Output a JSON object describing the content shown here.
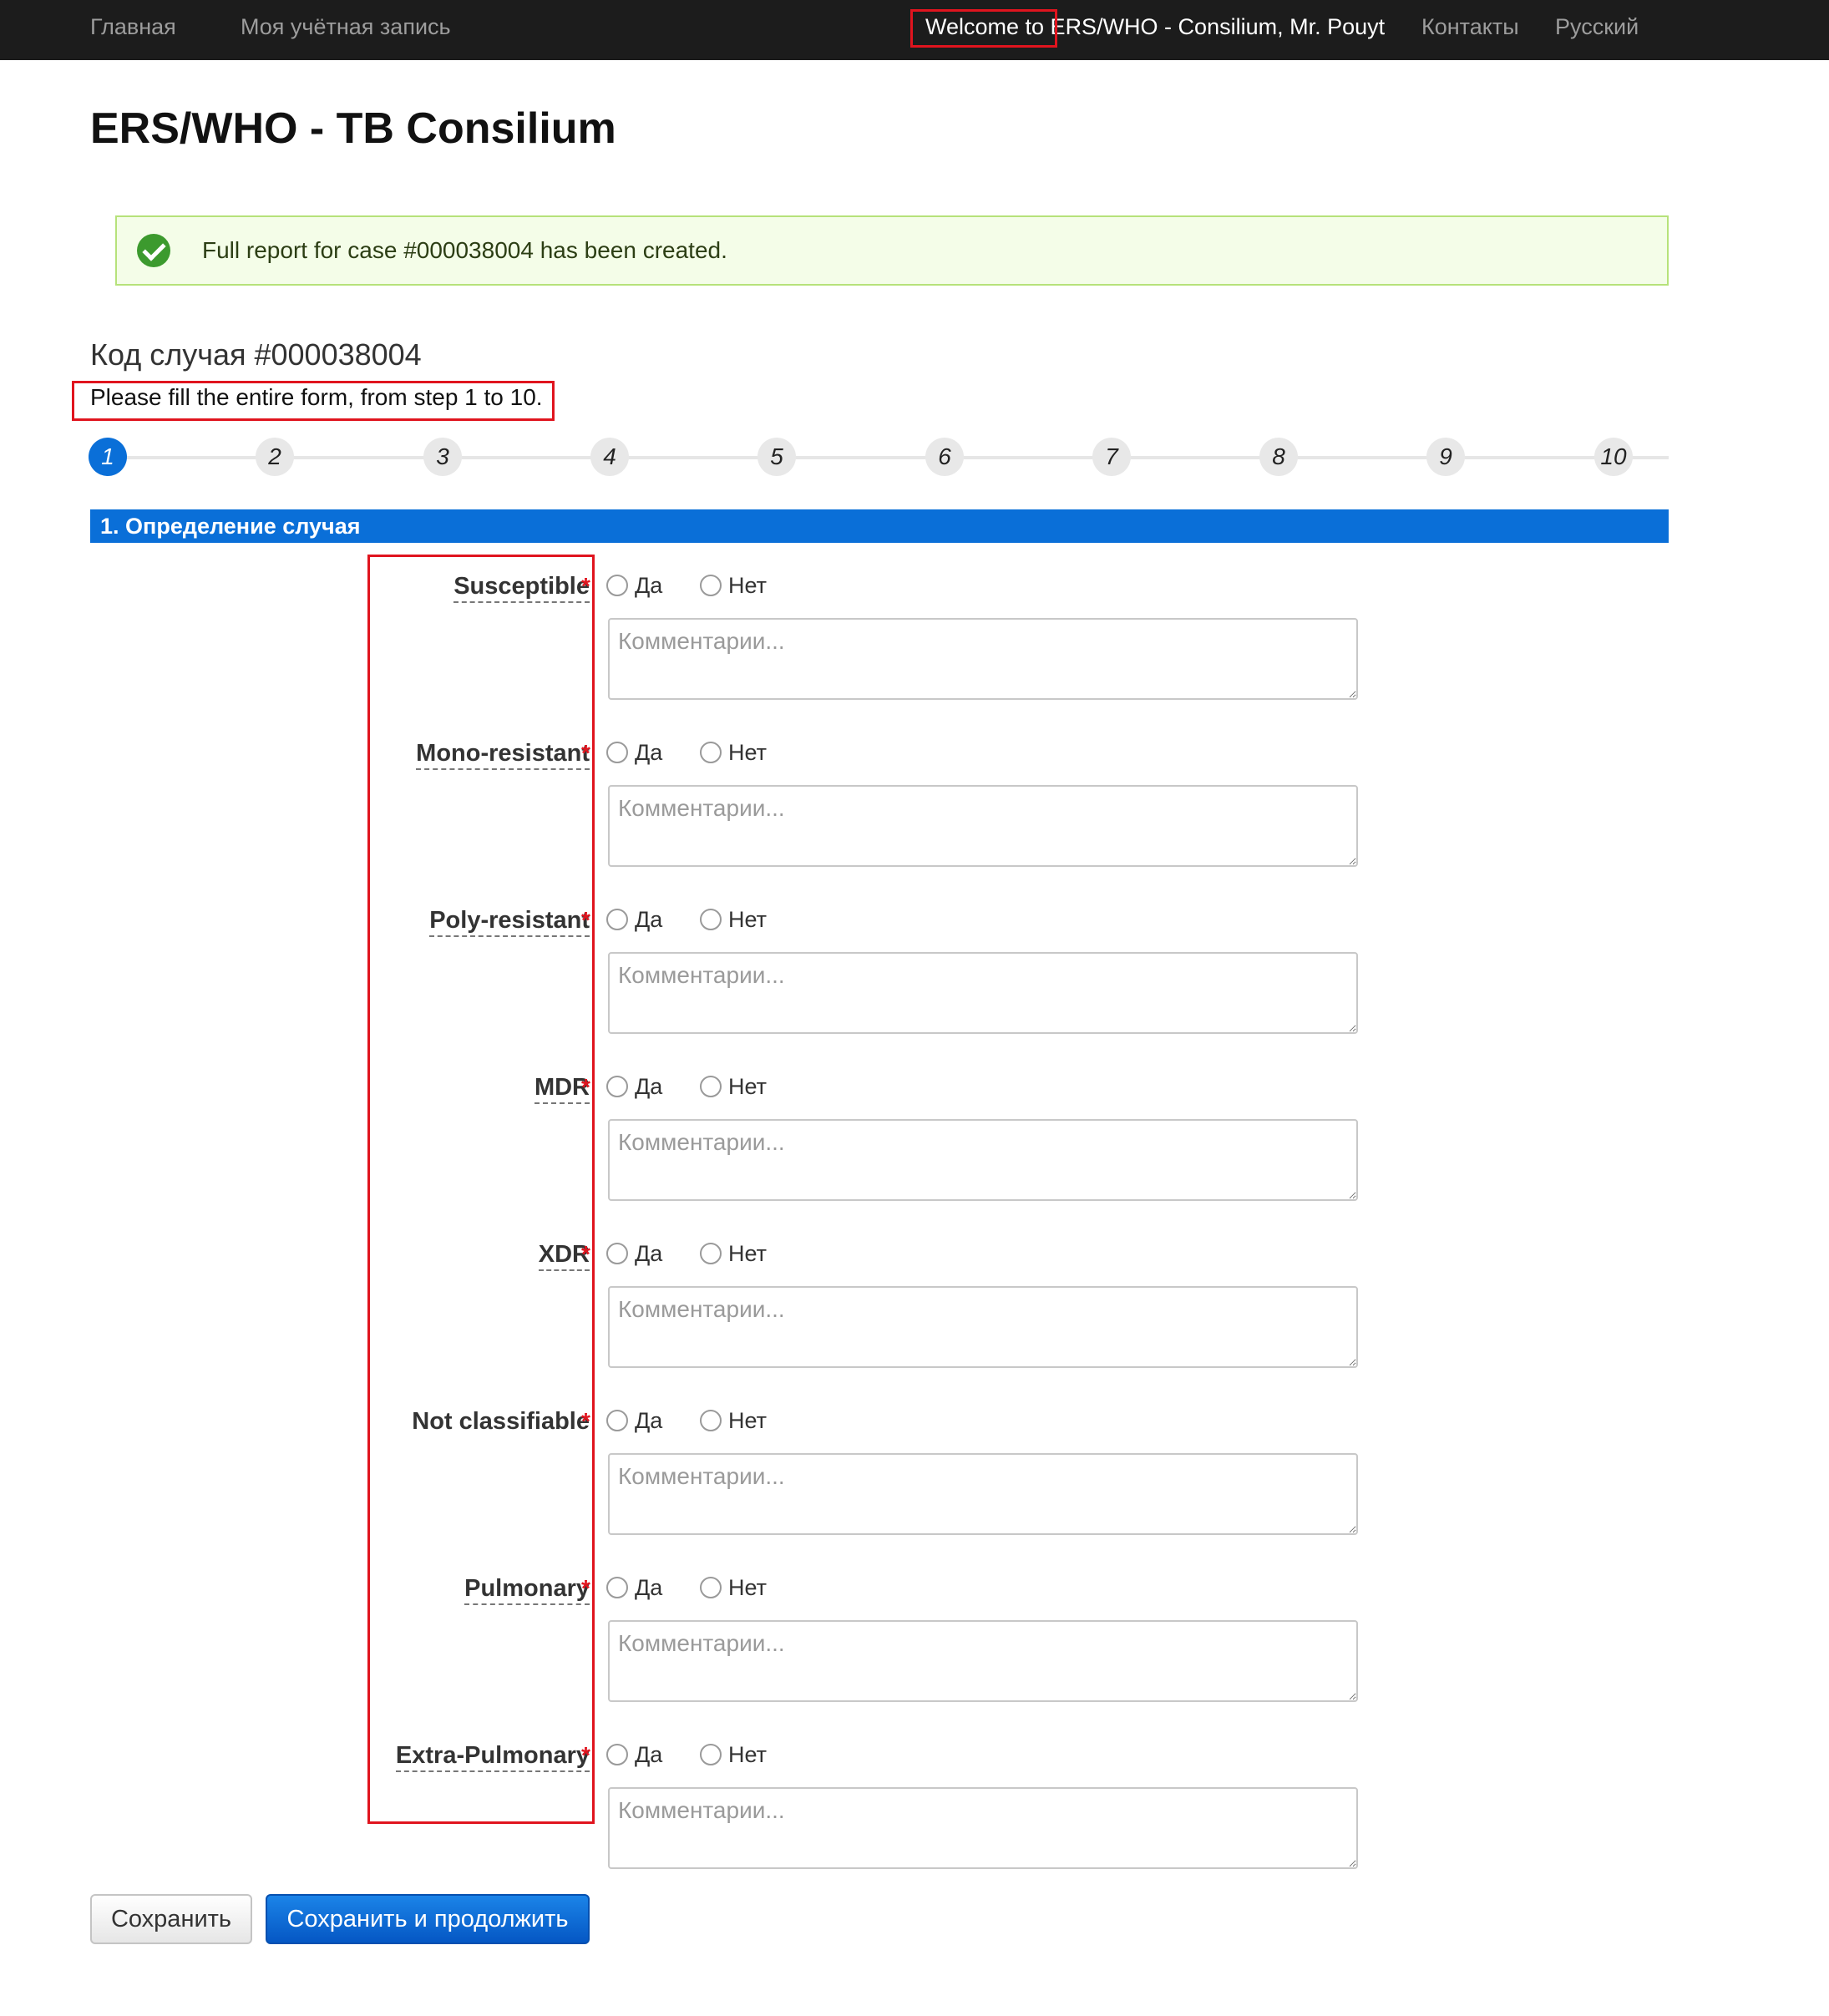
{
  "nav": {
    "home": "Главная",
    "account": "Моя учётная запись",
    "welcome": "Welcome to ERS/WHO - Consilium, Mr. Pouyt",
    "contacts": "Контакты",
    "language": "Русский"
  },
  "page_title": "ERS/WHO - TB Consilium",
  "alert": {
    "message": "Full report for case #000038004 has been created.",
    "icon": "check-circle-icon"
  },
  "case_code": "Код случая #000038004",
  "fill_note": "Please fill the entire form, from step 1 to 10.",
  "steps": [
    "1",
    "2",
    "3",
    "4",
    "5",
    "6",
    "7",
    "8",
    "9",
    "10"
  ],
  "active_step": "1",
  "section_title": "1. Определение случая",
  "form": {
    "yes_label": "Да",
    "no_label": "Нет",
    "required_mark": "*",
    "comment_placeholder": "Комментарии...",
    "fields": [
      {
        "label": "Susceptible"
      },
      {
        "label": "Mono-resistant"
      },
      {
        "label": "Poly-resistant"
      },
      {
        "label": "MDR"
      },
      {
        "label": "XDR"
      },
      {
        "label": "Not classifiable"
      },
      {
        "label": "Pulmonary"
      },
      {
        "label": "Extra-Pulmonary"
      }
    ]
  },
  "buttons": {
    "save": "Сохранить",
    "save_continue": "Сохранить и продолжить"
  },
  "colors": {
    "accent": "#0a6fd8",
    "nav_bg": "#1c1c1c",
    "alert_bg": "#f4fde8",
    "required": "#e0141e"
  }
}
